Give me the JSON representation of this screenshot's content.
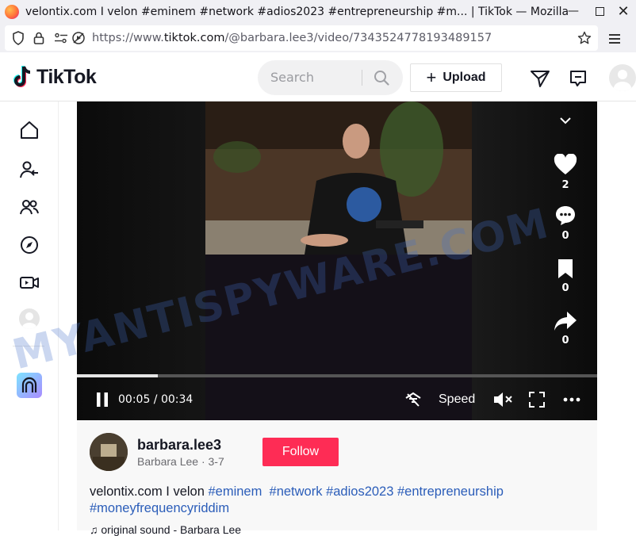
{
  "browser": {
    "window_title": "velontix.com I velon #eminem #network #adios2023 #entrepreneurship #m... | TikTok — Mozilla Fir...",
    "url_prefix": "https://www.",
    "url_domain": "tiktok.com",
    "url_path": "/@barbara.lee3/video/7343524778193489157"
  },
  "header": {
    "logo_text": "TikTok",
    "search_placeholder": "Search",
    "upload_label": "Upload"
  },
  "video": {
    "like_count": "2",
    "comment_count": "0",
    "bookmark_count": "0",
    "share_count": "0",
    "time": "00:05 / 00:34",
    "speed_label": "Speed",
    "progress": 0.155
  },
  "post": {
    "username": "barbara.lee3",
    "nickname_date": "Barbara Lee · 3-7",
    "follow_label": "Follow",
    "desc_plain": "velontix.com I velon ",
    "tags": [
      "#eminem",
      "#network",
      "#adios2023",
      "#entrepreneurship",
      "#moneyfrequencyriddim"
    ],
    "music_partial": "♫ original sound - Barbara Lee"
  },
  "watermark": "MYANTISPYWARE.COM",
  "colors": {
    "accent": "#fe2c55",
    "tag": "#2b5db9"
  }
}
